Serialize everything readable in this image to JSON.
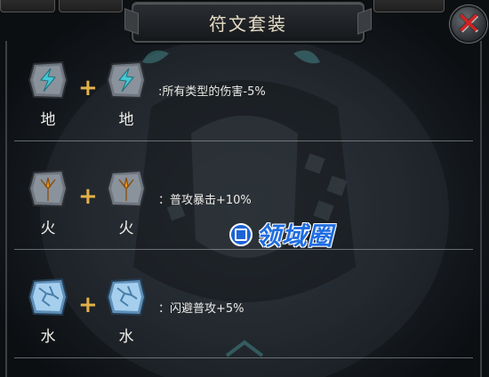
{
  "tabs": [
    "",
    "",
    ""
  ],
  "title": "符文套装",
  "close_label": "✕",
  "rows": [
    {
      "rune_a": "地",
      "rune_b": "地",
      "plus": "+",
      "effect": ":所有类型的伤害-5%",
      "element": "earth",
      "icon": "lightning-rune-icon",
      "color": "#45c8d6"
    },
    {
      "rune_a": "火",
      "rune_b": "火",
      "plus": "+",
      "effect": "：普攻暴击+10%",
      "element": "fire",
      "icon": "flame-rune-icon",
      "color": "#f0a020"
    },
    {
      "rune_a": "水",
      "rune_b": "水",
      "plus": "+",
      "effect": "：闪避普攻+5%",
      "element": "water",
      "icon": "crack-rune-icon",
      "color": "#6fb8e8"
    }
  ],
  "watermark": {
    "text": "领域圈",
    "brand_color": "#1f6de0"
  }
}
